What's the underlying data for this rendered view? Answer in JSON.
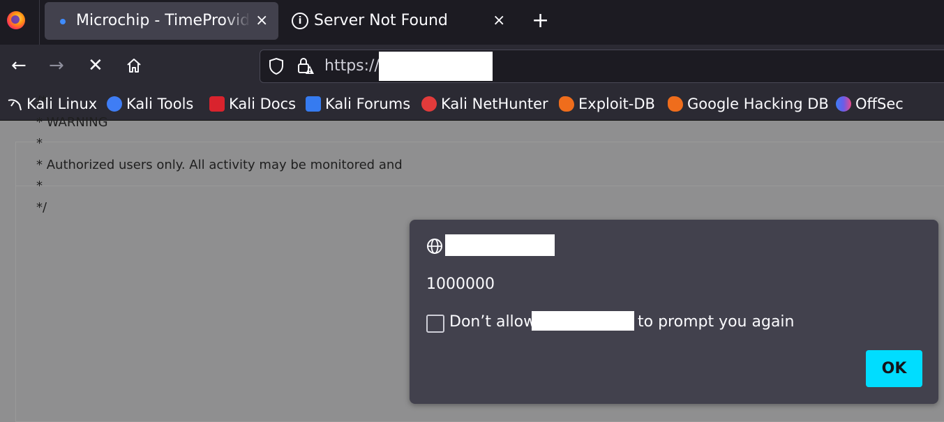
{
  "tabs": [
    {
      "title": "Microchip - TimeProvider",
      "active": true
    },
    {
      "title": "Server Not Found",
      "active": false
    }
  ],
  "nav": {
    "back_glyph": "←",
    "forward_glyph": "→",
    "stop_glyph": "✕",
    "new_tab_glyph": "+",
    "tab_close_glyph": "×",
    "url_prefix": "https://"
  },
  "bookmarks": [
    {
      "label": "Kali Linux",
      "icon": "kali-dragon-icon",
      "color": "#2b2a33"
    },
    {
      "label": "Kali Tools",
      "icon": "kali-tools-icon",
      "color": "#3f7df5"
    },
    {
      "label": "Kali Docs",
      "icon": "kali-docs-icon",
      "color": "#d9232d"
    },
    {
      "label": "Kali Forums",
      "icon": "kali-forums-icon",
      "color": "#367bf0"
    },
    {
      "label": "Kali NetHunter",
      "icon": "kali-nethunter-icon",
      "color": "#e23b3b"
    },
    {
      "label": "Exploit-DB",
      "icon": "exploit-db-icon",
      "color": "#ef6d1c"
    },
    {
      "label": "Google Hacking DB",
      "icon": "ghdb-icon",
      "color": "#ef6d1c"
    },
    {
      "label": "OffSec",
      "icon": "offsec-icon",
      "color": "#6c5ce7"
    }
  ],
  "page": {
    "code_lines": [
      "/*",
      "* WARNING",
      "*",
      "* Authorized users only. All activity may be monitored and",
      "*",
      "*/"
    ]
  },
  "dialog": {
    "message": "1000000",
    "checkbox_label_prefix": "Don’t allow",
    "checkbox_label_suffix": "to prompt you again",
    "ok_label": "OK"
  },
  "colors": {
    "accent": "#00ddff",
    "tab_active": "#42414d",
    "toolbar": "#2b2a33"
  }
}
